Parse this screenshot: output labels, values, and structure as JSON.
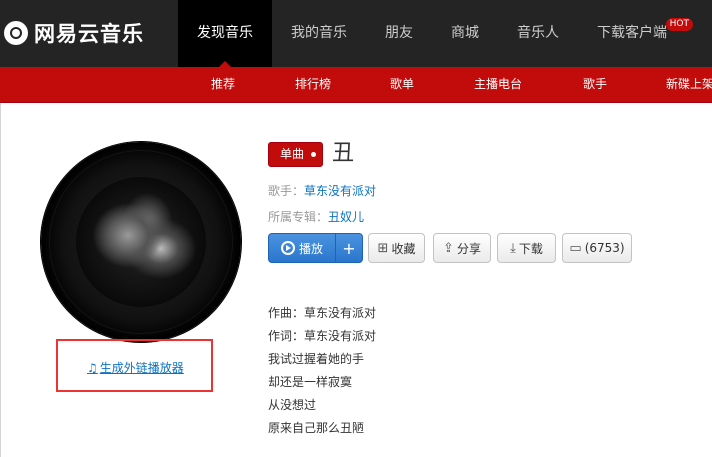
{
  "header": {
    "logo_text": "网易云音乐",
    "nav": [
      {
        "label": "发现音乐",
        "active": true
      },
      {
        "label": "我的音乐"
      },
      {
        "label": "朋友"
      },
      {
        "label": "商城"
      },
      {
        "label": "音乐人"
      },
      {
        "label": "下载客户端",
        "badge": "HOT"
      }
    ]
  },
  "subnav": {
    "items": [
      "推荐",
      "排行榜",
      "歌单",
      "主播电台",
      "歌手",
      "新碟上架"
    ]
  },
  "player_link": {
    "label": "生成外链播放器",
    "icon": "music-note-icon"
  },
  "song": {
    "tag": "单曲",
    "title": "丑",
    "singer_label": "歌手：",
    "singer": "草东没有派对",
    "album_label": "所属专辑：",
    "album": "丑奴儿"
  },
  "actions": {
    "play": "播放",
    "add": "+",
    "collect": "收藏",
    "share": "分享",
    "download": "下载",
    "comment": "(6753)"
  },
  "lyrics": [
    "作曲：草东没有派对",
    "作词：草东没有派对",
    "我试过握着她的手",
    "却还是一样寂寞",
    "从没想过",
    "原来自己那么丑陋"
  ],
  "colors": {
    "brand_red": "#c20c0c",
    "topbar": "#242424",
    "link_blue": "#0c73c2",
    "play_blue": "#2a76cd"
  }
}
